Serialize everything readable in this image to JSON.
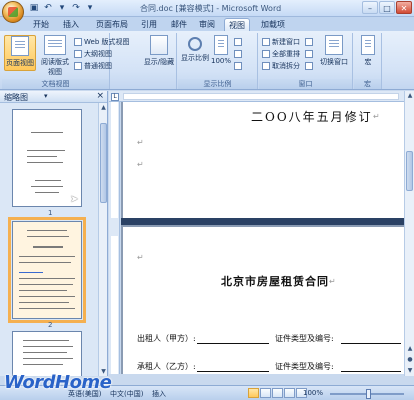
{
  "window": {
    "title": "合同.doc [兼容模式] - Microsoft Word"
  },
  "qat": {
    "save_icon": "save-icon",
    "undo_icon": "undo-icon",
    "redo_icon": "redo-icon"
  },
  "tabs": [
    "开始",
    "插入",
    "页面布局",
    "引用",
    "邮件",
    "审阅",
    "视图",
    "加载项"
  ],
  "active_tab": "视图",
  "ribbon": {
    "doc_views": {
      "label": "文档视图",
      "page_view": "页面视图",
      "reading_view": "阅读版式视图",
      "web_view": "Web 版式视图",
      "outline_view": "大纲视图",
      "draft_view": "普通视图"
    },
    "show_hide": {
      "label": "显示/隐藏"
    },
    "zoom": {
      "label": "显示比例",
      "zoom_btn": "显示比例",
      "percent": "100%"
    },
    "window": {
      "label": "窗口",
      "new_window": "新建窗口",
      "arrange_all": "全部重排",
      "split": "取消拆分",
      "switch_window": "切换窗口"
    },
    "macros": {
      "label": "宏",
      "btn": "宏"
    }
  },
  "nav_pane": {
    "title": "缩略图",
    "thumbnail_numbers": [
      "1",
      "2"
    ]
  },
  "document": {
    "page1_line": "二OO八年五月修订",
    "page2_title": "北京市房屋租赁合同",
    "lessor_label": "出租人（甲方）:",
    "lessor_id_label": "证件类型及编号:",
    "lessee_label": "承租人（乙方）:",
    "lessee_id_label": "证件类型及编号:"
  },
  "status_bar": {
    "language": "英语(美国)",
    "language2": "中文(中国)",
    "mode": "插入",
    "zoom_percent": "100%"
  },
  "watermark": "WordHome"
}
